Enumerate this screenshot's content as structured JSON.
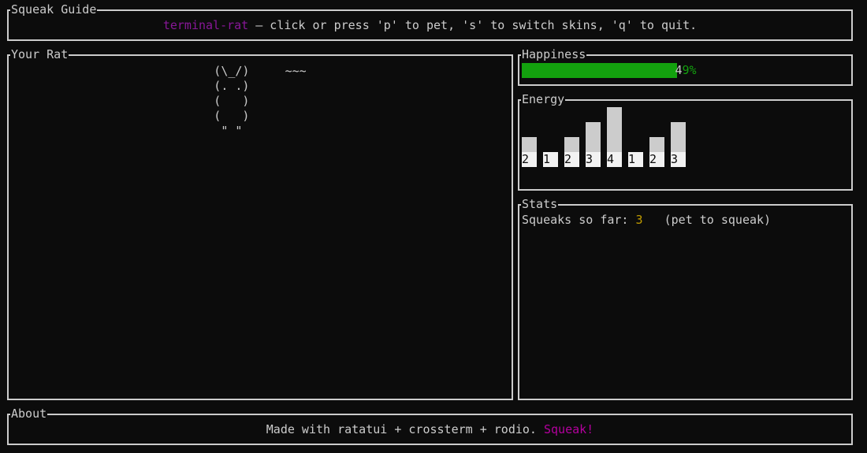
{
  "guide": {
    "title": "Squeak Guide",
    "app_name": "terminal-rat",
    "instructions": " — click or press 'p' to pet, 's' to switch skins, 'q' to quit."
  },
  "rat_panel": {
    "title": "Your Rat",
    "art_lines": [
      "(\\_/)     ~~~",
      "(. .)        ",
      "(   )        ",
      "(   )        ",
      " \" \"         "
    ]
  },
  "happiness": {
    "title": "Happiness",
    "value": 0.49,
    "label": "49%",
    "color": "#13a10e"
  },
  "energy": {
    "title": "Energy",
    "chart_data": {
      "type": "bar",
      "values": [
        2,
        1,
        2,
        3,
        4,
        1,
        2,
        3
      ],
      "max": 4
    }
  },
  "stats": {
    "title": "Stats",
    "squeaks_label": "Squeaks so far: ",
    "squeaks_value": "3",
    "hint": "   (pet to squeak)"
  },
  "about": {
    "title": "About",
    "text": "Made with ratatui + crossterm + rodio. ",
    "exclaim": "Squeak!"
  },
  "colors": {
    "background": "#0c0c0c",
    "foreground": "#cccccc",
    "app_name": "#881798",
    "squeak": "#b4009e",
    "count": "#c19c00",
    "gauge": "#13a10e"
  }
}
